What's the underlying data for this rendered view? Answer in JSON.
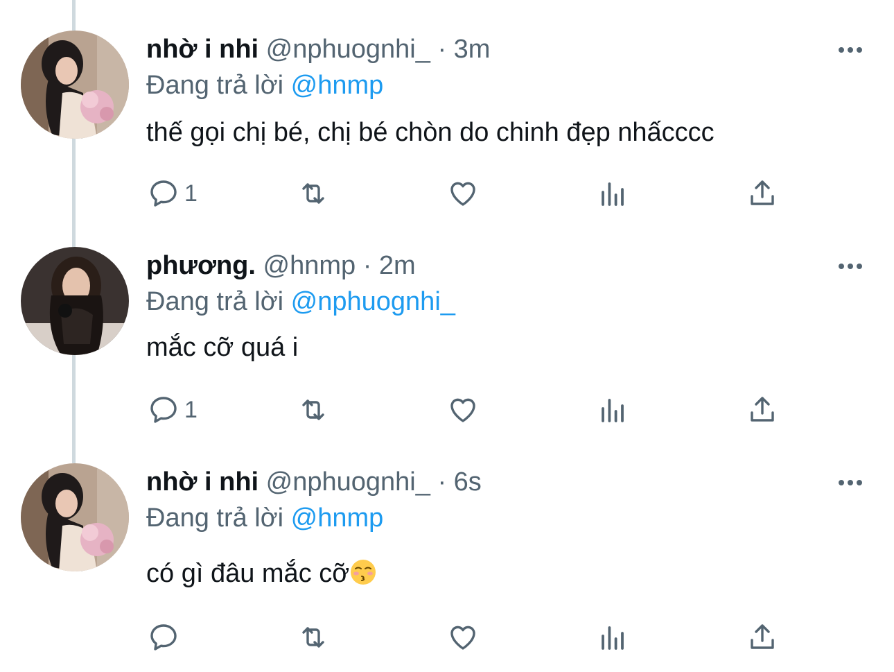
{
  "tweets": [
    {
      "name": "nhờ i nhi",
      "handle": "@nphuognhi_",
      "separator": "·",
      "time": "3m",
      "replying_prefix": "Đang trả lời",
      "replying_to": "@hnmp",
      "text": "thế gọi chị bé, chị bé chòn do chinh đẹp nhấcccc",
      "reply_count": "1",
      "avatar_icon": "avatar-photo-woman-flowers"
    },
    {
      "name": "phương.",
      "handle": "@hnmp",
      "separator": "·",
      "time": "2m",
      "replying_prefix": "Đang trả lời",
      "replying_to": "@nphuognhi_",
      "text": "mắc cỡ quá i",
      "reply_count": "1",
      "avatar_icon": "avatar-photo-woman-dark"
    },
    {
      "name": "nhờ i nhi",
      "handle": "@nphuognhi_",
      "separator": "·",
      "time": "6s",
      "replying_prefix": "Đang trả lời",
      "replying_to": "@hnmp",
      "text": "có gì đâu mắc cỡ",
      "text_emoji": "kissing-face-emoji",
      "reply_count": "",
      "avatar_icon": "avatar-photo-woman-flowers"
    }
  ],
  "icons": {
    "reply": "reply-icon",
    "retweet": "retweet-icon",
    "like": "like-icon",
    "analytics": "analytics-icon",
    "share": "share-icon",
    "more": "more-icon"
  },
  "colors": {
    "text": "#0f1419",
    "secondary": "#536471",
    "mention": "#1d9bf0",
    "thread_line": "#cfd9de"
  }
}
